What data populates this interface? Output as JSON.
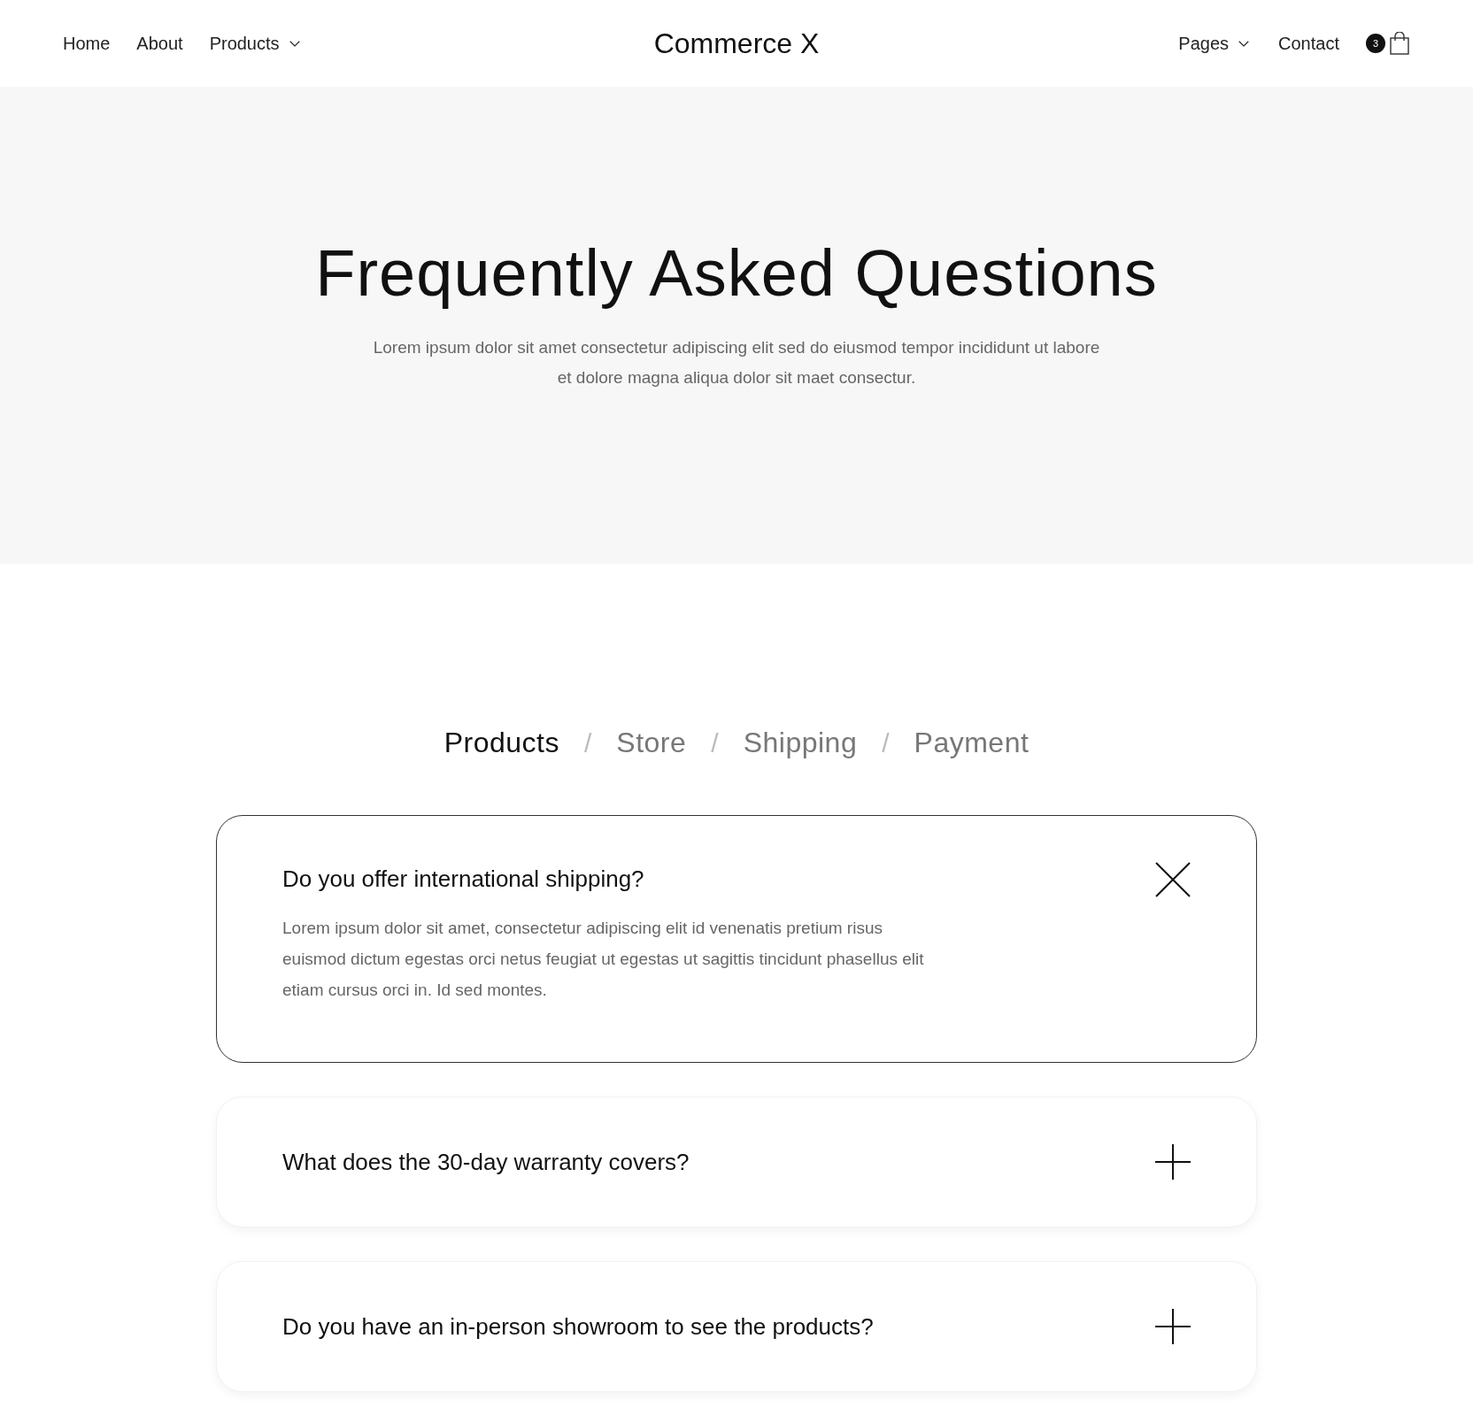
{
  "nav": {
    "left": [
      {
        "label": "Home",
        "dropdown": false
      },
      {
        "label": "About",
        "dropdown": false
      },
      {
        "label": "Products",
        "dropdown": true
      }
    ],
    "logo": "Commerce X",
    "right": [
      {
        "label": "Pages",
        "dropdown": true
      },
      {
        "label": "Contact",
        "dropdown": false
      }
    ],
    "cart_count": "3"
  },
  "hero": {
    "title": "Frequently Asked Questions",
    "subtitle": "Lorem ipsum dolor sit amet consectetur adipiscing elit sed do eiusmod tempor incididunt ut labore et dolore magna aliqua dolor sit maet consectur."
  },
  "tabs": [
    {
      "label": "Products",
      "selected": true
    },
    {
      "label": "Store",
      "selected": false
    },
    {
      "label": "Shipping",
      "selected": false
    },
    {
      "label": "Payment",
      "selected": false
    }
  ],
  "tab_separator": "/",
  "faqs": [
    {
      "question": "Do you offer international shipping?",
      "expanded": true,
      "answer": "Lorem ipsum dolor sit amet, consectetur adipiscing elit id venenatis pretium risus euismod dictum egestas orci netus feugiat ut egestas ut sagittis tincidunt phasellus elit etiam cursus orci in. Id sed montes."
    },
    {
      "question": "What does the 30-day warranty covers?",
      "expanded": false
    },
    {
      "question": "Do you have an in-person showroom to see the products?",
      "expanded": false
    }
  ]
}
